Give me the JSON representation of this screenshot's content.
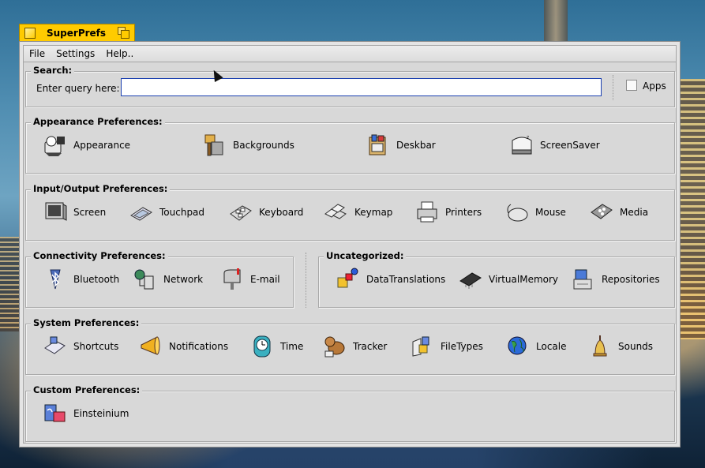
{
  "window": {
    "title": "SuperPrefs"
  },
  "menubar": {
    "items": [
      "File",
      "Settings",
      "Help.."
    ]
  },
  "search": {
    "section_title": "Search:",
    "label": "Enter query here:",
    "value": "",
    "apps_label": "Apps",
    "apps_checked": false
  },
  "sections": {
    "appearance": {
      "title": "Appearance Preferences:",
      "items": [
        "Appearance",
        "Backgrounds",
        "Deskbar",
        "ScreenSaver"
      ]
    },
    "io": {
      "title": "Input/Output Preferences:",
      "items": [
        "Screen",
        "Touchpad",
        "Keyboard",
        "Keymap",
        "Printers",
        "Mouse",
        "Media"
      ]
    },
    "connectivity": {
      "title": "Connectivity Preferences:",
      "items": [
        "Bluetooth",
        "Network",
        "E-mail"
      ]
    },
    "uncategorized": {
      "title": "Uncategorized:",
      "items": [
        "DataTranslations",
        "VirtualMemory",
        "Repositories"
      ]
    },
    "system": {
      "title": "System Preferences:",
      "items": [
        "Shortcuts",
        "Notifications",
        "Time",
        "Tracker",
        "FileTypes",
        "Locale",
        "Sounds"
      ]
    },
    "custom": {
      "title": "Custom Preferences:",
      "items": [
        "Einsteinium"
      ]
    }
  },
  "colors": {
    "tab": "#ffcb00",
    "window": "#d8d8d8",
    "focus": "#1a3fb0"
  }
}
